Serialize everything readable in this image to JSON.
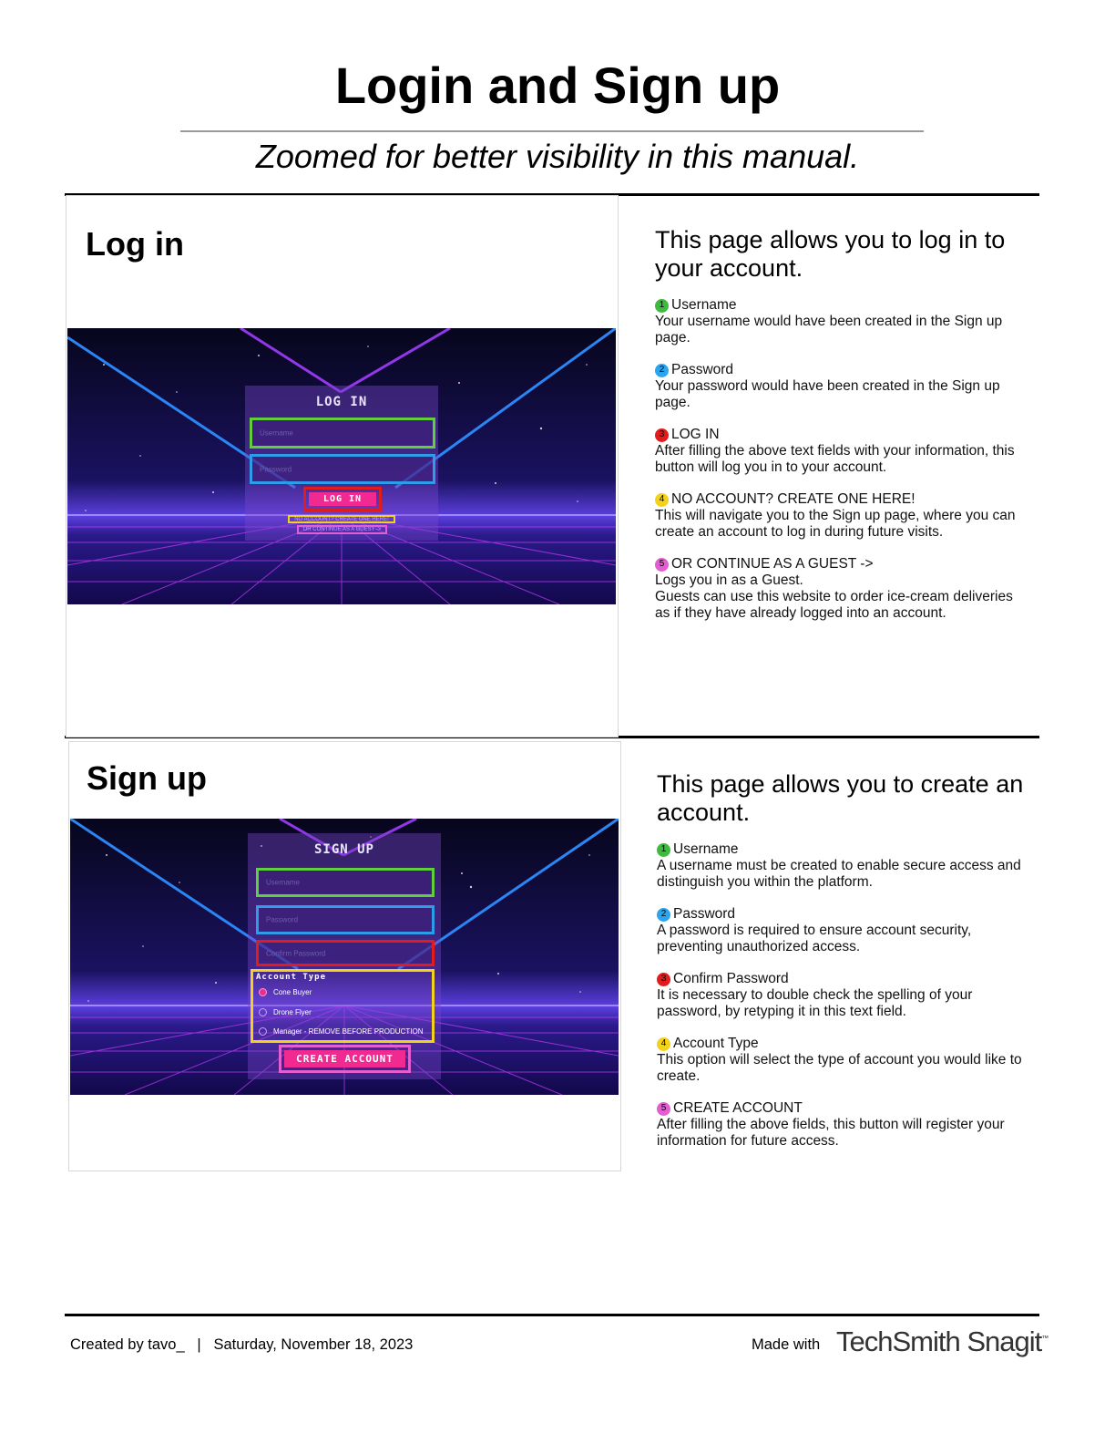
{
  "document": {
    "title": "Login and Sign up",
    "subtitle": "Zoomed for better visibility in this manual."
  },
  "colors": {
    "green": "#3fb93f",
    "blue": "#29a6ef",
    "red": "#e21c1c",
    "yellow": "#f3d21b",
    "pink": "#e35fd1",
    "button_pink": "#f02a91"
  },
  "login_section": {
    "panel_title": "Log in",
    "heading": "This page allows you to log in to your account.",
    "items": [
      {
        "number": "1",
        "title": "Username",
        "body": "Your username would have been created in the Sign up page."
      },
      {
        "number": "2",
        "title": "Password",
        "body": "Your password would have been created in the Sign up page."
      },
      {
        "number": "3",
        "title": "LOG IN",
        "body": "After filling the above text fields with your information, this button will log you in to your account."
      },
      {
        "number": "4",
        "title": "NO ACCOUNT? CREATE ONE HERE!",
        "body": "This will navigate you to the Sign up page, where you can create an account to log in during future visits."
      },
      {
        "number": "5",
        "title": "OR CONTINUE AS A GUEST ->",
        "body": "Logs you in as a Guest.",
        "body2": "Guests can use this website to order ice-cream deliveries as if they have already logged into an account."
      }
    ],
    "screenshot": {
      "form_title": "LOG IN",
      "username_placeholder": "Username",
      "password_placeholder": "Password",
      "login_button": "LOG IN",
      "create_link": "NO ACCOUNT? CREATE ONE HERE!",
      "guest_link": "OR CONTINUE AS A GUEST ->"
    }
  },
  "signup_section": {
    "panel_title": "Sign up",
    "heading": "This page allows you to create an account.",
    "items": [
      {
        "number": "1",
        "title": "Username",
        "body": "A username must be created to enable secure access and distinguish you within the platform."
      },
      {
        "number": "2",
        "title": "Password",
        "body": "A password is required to ensure account security, preventing unauthorized access."
      },
      {
        "number": "3",
        "title": "Confirm Password",
        "body": "It is necessary to double check the spelling of your password, by retyping it in this text field."
      },
      {
        "number": "4",
        "title": "Account Type",
        "body": "This option will select the type of account you would like to create."
      },
      {
        "number": "5",
        "title": "CREATE ACCOUNT",
        "body": "After filling the above fields, this button will register your information for future access."
      }
    ],
    "screenshot": {
      "form_title": "SIGN UP",
      "username_placeholder": "Username",
      "password_placeholder": "Password",
      "confirm_placeholder": "Confirm Password",
      "account_type_label": "Account Type",
      "options": [
        "Cone Buyer",
        "Drone Flyer",
        "Manager - REMOVE BEFORE PRODUCTION"
      ],
      "selected_option": "Cone Buyer",
      "create_button": "CREATE ACCOUNT"
    }
  },
  "footer": {
    "created_by": "Created by tavo_   |   Saturday, November 18, 2023",
    "made_with": "Made with",
    "brand": "TechSmith Snagit",
    "brand_tm": "™"
  }
}
